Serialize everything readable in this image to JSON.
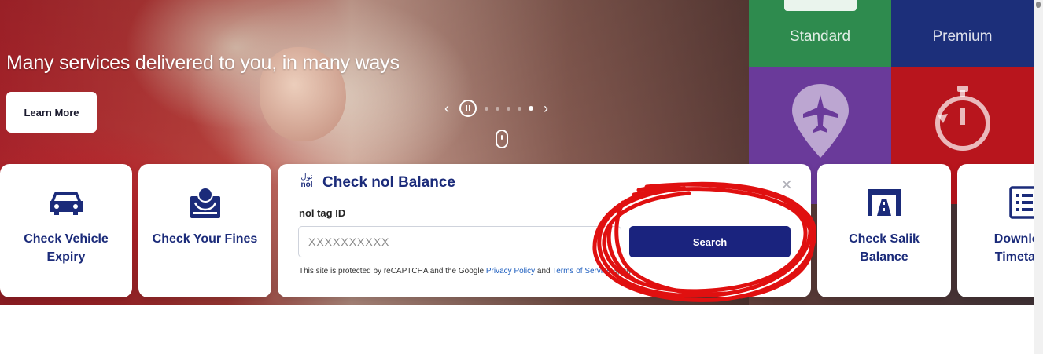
{
  "hero": {
    "title": "Many services delivered to you, in many ways",
    "learn_more_label": "Learn More",
    "carousel": {
      "prev_glyph": "‹",
      "next_glyph": "›",
      "slide_count": 5,
      "active_slide": 5
    }
  },
  "tiles": {
    "standard_label": "Standard",
    "premium_label": "Premium",
    "colors": {
      "standard": "#2e8b4e",
      "premium": "#1c2f7a",
      "purple": "#6a3a9a",
      "red": "#b8151d"
    }
  },
  "cards": {
    "vehicle_expiry": "Check Vehicle\nExpiry",
    "fines": "Check Your Fines",
    "salik": "Check Salik\nBalance",
    "timetable": "Download\nTimetable"
  },
  "nol": {
    "logo_line1": "نول",
    "logo_line2": "nol",
    "title": "Check nol Balance",
    "close_glyph": "×",
    "field_label": "nol tag ID",
    "placeholder": "XXXXXXXXXX",
    "search_label": "Search",
    "note_prefix": "This site is protected by reCAPTCHA and the Google ",
    "privacy_link": "Privacy Policy",
    "note_and": " and ",
    "terms_link": "Terms of Service",
    "note_suffix": " apply."
  },
  "accent": {
    "brand_blue": "#1a237e",
    "annotation_red": "#e01010"
  }
}
